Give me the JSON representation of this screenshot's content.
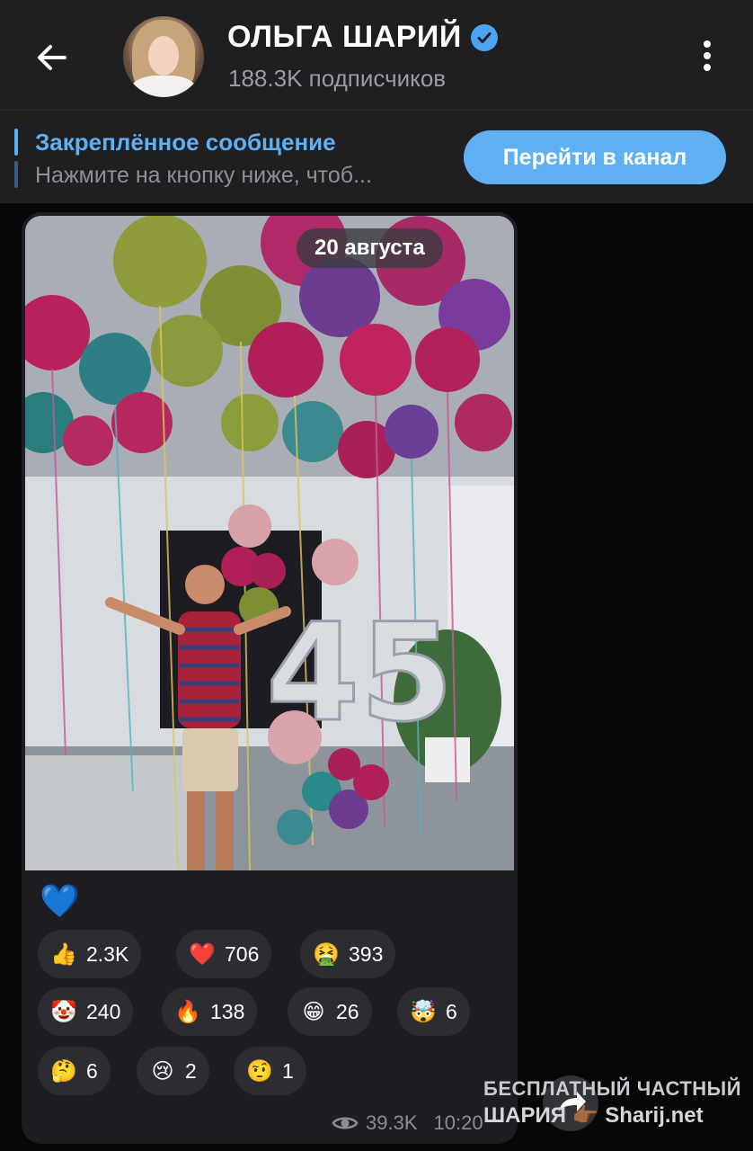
{
  "header": {
    "channel_name": "ОЛЬГА ШАРИЙ",
    "subscribers": "188.3K подписчиков",
    "back_icon": "arrow-left-icon",
    "menu_icon": "more-vertical-icon"
  },
  "pinned": {
    "title": "Закреплённое сообщение",
    "text": "Нажмите на кнопку ниже, чтоб...",
    "button_label": "Перейти в канал"
  },
  "message": {
    "date": "20 августа",
    "text_emoji": "💙",
    "reactions": [
      {
        "emoji": "👍",
        "count": "2.3K"
      },
      {
        "emoji": "❤️",
        "count": "706"
      },
      {
        "emoji": "🤮",
        "count": "393"
      },
      {
        "emoji": "🤡",
        "count": "240"
      },
      {
        "emoji": "🔥",
        "count": "138"
      },
      {
        "emoji": "😁",
        "count": "26"
      },
      {
        "emoji": "🤯",
        "count": "6"
      },
      {
        "emoji": "🤔",
        "count": "6"
      },
      {
        "emoji": "😢",
        "count": "2"
      },
      {
        "emoji": "🤨",
        "count": "1"
      }
    ],
    "views": "39.3K",
    "time": "10:20"
  },
  "watermark": {
    "line1": "БЕСПЛАТНЫЙ ЧАСТНЫЙ",
    "line2": "ШАРИЯ",
    "site": "Sharij.net"
  },
  "colors": {
    "accent": "#5eb0f2",
    "header_bg": "#1f1f22",
    "bubble_bg": "#1e1e22",
    "reaction_bg": "#2c2c33"
  }
}
